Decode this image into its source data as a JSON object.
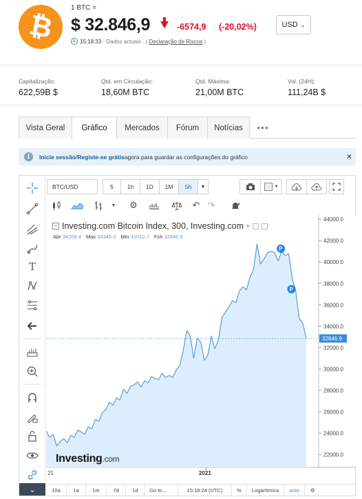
{
  "header": {
    "unit_label": "1 BTC =",
    "price": "$ 32.846,9",
    "change": "-6574,9",
    "change_pct": "(-20,02%)",
    "currency": "USD",
    "time": "15:18:33",
    "status_sep": " - Dados actuais . ( ",
    "risk_link": "Declaração de Riscos",
    "status_end": " )",
    "logo_symbol": "₿",
    "down_color": "#e0102b",
    "logo_color": "#f7931a"
  },
  "stats": [
    {
      "label": "Capitalização:",
      "value": "622,59B $"
    },
    {
      "label": "Qtd. em Circulação:",
      "value": "18,60M BTC"
    },
    {
      "label": "Qtd. Máxima:",
      "value": "21,00M BTC"
    },
    {
      "label": "Vol. (24H):",
      "value": "111,24B $"
    }
  ],
  "tabs": [
    {
      "label": "Vista Geral"
    },
    {
      "label": "Gráfico"
    },
    {
      "label": "Mercados"
    },
    {
      "label": "Fórum"
    },
    {
      "label": "Notícias"
    }
  ],
  "tabs_more": "•••",
  "info_bar": {
    "login": "Inicie sessão",
    "sep": " / ",
    "register": "Registe-se grátis",
    "rest": " agora para guardar as configurações do gráfico",
    "close": "×"
  },
  "chart_toolbar": {
    "symbol": "BTC/USD",
    "intervals": [
      "5",
      "1h",
      "1D",
      "1M",
      "5h"
    ],
    "active_interval": "5h"
  },
  "chart_legend": {
    "title": "Investing.com Bitcoin Index, 300, Investing.com",
    "open_label": "Abr",
    "open": "34209.4",
    "high_label": "Max",
    "high": "34345.0",
    "low_label": "Min",
    "low": "31012.7",
    "close_label": "Fch",
    "close": "32846.9",
    "watermark_main": "Investing",
    "watermark_suffix": ".com"
  },
  "bottom_bar": [
    "10a",
    "1a",
    "1m",
    "7d",
    "1d",
    "Go to...",
    "15:18:24 (UTC)",
    "%",
    "Logarítmica",
    "auto"
  ],
  "chart_data": {
    "type": "area",
    "title": "Investing.com Bitcoin Index, 300, Investing.com",
    "x_tick_labels": [
      "21",
      "2021"
    ],
    "y_tick_labels": [
      "44000.0",
      "42000.0",
      "40000.0",
      "38000.0",
      "36000.0",
      "34000.0",
      "32000.0",
      "30000.0",
      "28000.0",
      "26000.0",
      "24000.0",
      "22000.0"
    ],
    "ylim": [
      20800,
      44400
    ],
    "last_price_label": "32846.9",
    "markers": [
      "P",
      "P"
    ],
    "y": [
      24200,
      23600,
      23900,
      22800,
      23200,
      23500,
      23100,
      23800,
      23600,
      24300,
      24100,
      23900,
      24600,
      24400,
      25300,
      25100,
      25900,
      26200,
      26900,
      26600,
      27300,
      27100,
      28100,
      27700,
      28400,
      28500,
      28800,
      28300,
      28900,
      28700,
      29300,
      29100,
      29000,
      29600,
      29200,
      29400,
      29200,
      29900,
      30300,
      31700,
      33600,
      33100,
      31000,
      32900,
      32500,
      30800,
      31300,
      33100,
      31900,
      32700,
      34800,
      35300,
      35800,
      36400,
      36200,
      37300,
      37700,
      37400,
      38600,
      39300,
      41700,
      39800,
      40300,
      40900,
      41000,
      40900,
      40100,
      41000,
      40600,
      40800,
      38500,
      37300,
      34700,
      34300,
      32850
    ],
    "line_color": "#5d9bd3",
    "fill_color": "#dceefb"
  }
}
